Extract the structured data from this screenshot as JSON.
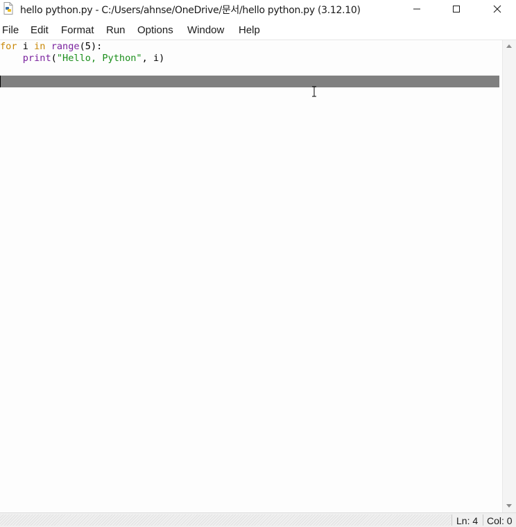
{
  "window": {
    "title": "hello python.py - C:/Users/ahnse/OneDrive/문서/hello python.py (3.12.10)"
  },
  "menu": {
    "items": [
      "File",
      "Edit",
      "Format",
      "Run",
      "Options",
      "Window",
      "Help"
    ]
  },
  "editor": {
    "lines": [
      {
        "kw": "for",
        "t1": " i ",
        "kw2": "in",
        "t2": " ",
        "bi": "range",
        "t3": "(5):"
      },
      {
        "indent": "    ",
        "bi": "print",
        "t1": "(",
        "str": "\"Hello, Python\"",
        "t2": ", i)"
      }
    ],
    "current_line": 4
  },
  "status": {
    "line": "Ln: 4",
    "col": "Col: 0"
  },
  "colors": {
    "keyword": "#c98806",
    "builtin": "#7a229e",
    "string": "#1b8e1b",
    "current_line_highlight": "#808080"
  },
  "icons": {
    "app": "python-file-icon",
    "minimize": "minimize-icon",
    "maximize": "maximize-icon",
    "close": "close-icon"
  }
}
